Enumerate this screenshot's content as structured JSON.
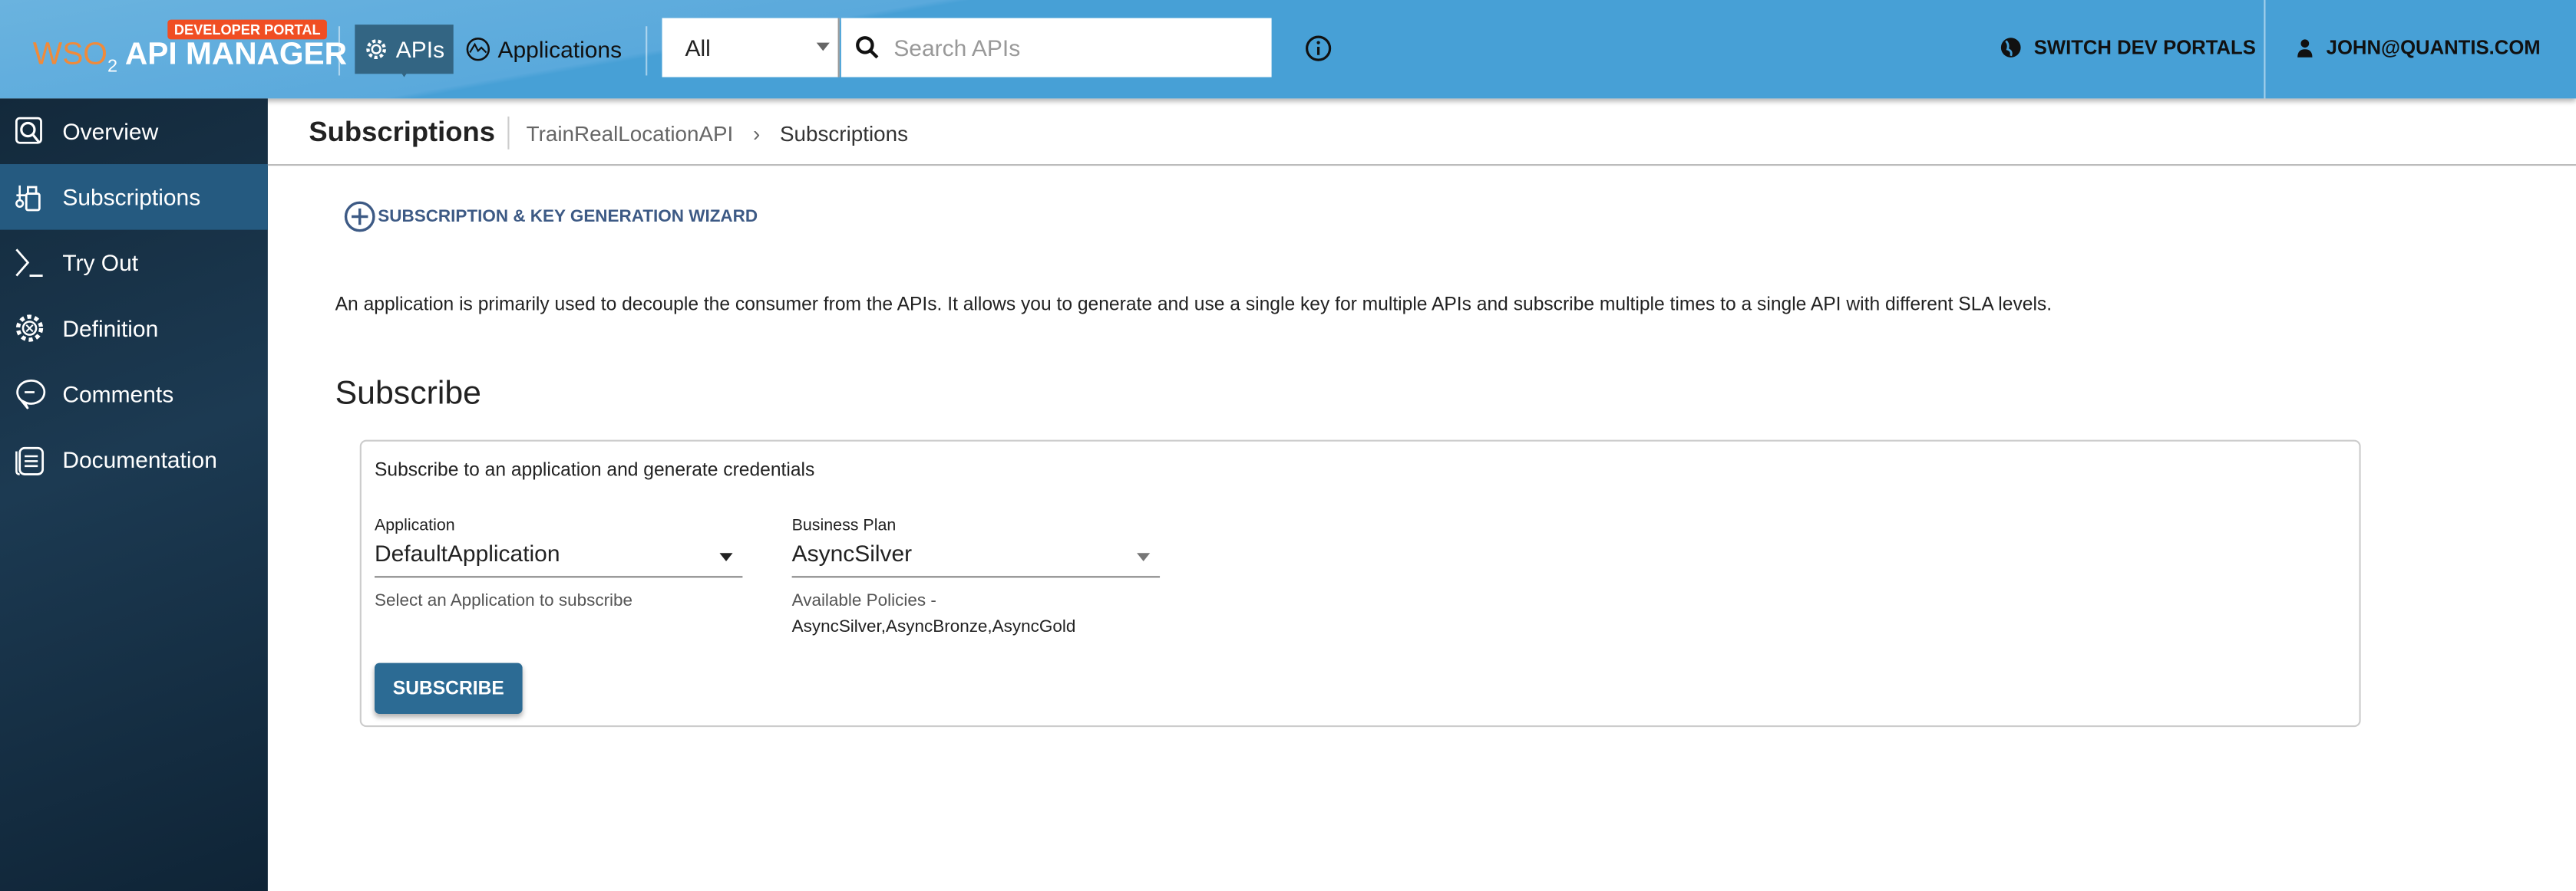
{
  "header": {
    "badge": "DEVELOPER PORTAL",
    "logo_wso": "WSO",
    "logo_two": "2",
    "app_title": "API MANAGER",
    "nav": [
      {
        "label": "APIs",
        "icon": "gear-icon"
      },
      {
        "label": "Applications",
        "icon": "app-icon"
      }
    ],
    "filter_selected": "All",
    "search_placeholder": "Search APIs",
    "switch_portals": "SWITCH DEV PORTALS",
    "user": "JOHN@QUANTIS.COM"
  },
  "sidebar": {
    "items": [
      {
        "label": "Overview",
        "icon": "overview-icon"
      },
      {
        "label": "Subscriptions",
        "icon": "subscriptions-icon"
      },
      {
        "label": "Try Out",
        "icon": "terminal-icon"
      },
      {
        "label": "Definition",
        "icon": "gear-icon"
      },
      {
        "label": "Comments",
        "icon": "comment-icon"
      },
      {
        "label": "Documentation",
        "icon": "document-icon"
      }
    ]
  },
  "breadcrumb": {
    "title": "Subscriptions",
    "api": "TrainRealLocationAPI",
    "current": "Subscriptions"
  },
  "main": {
    "wizard_label": "SUBSCRIPTION & KEY GENERATION WIZARD",
    "description": "An application is primarily used to decouple the consumer from the APIs. It allows you to generate and use a single key for multiple APIs and subscribe multiple times to a single API with different SLA levels.",
    "heading": "Subscribe",
    "card": {
      "subtitle": "Subscribe to an application and generate credentials",
      "application_label": "Application",
      "application_value": "DefaultApplication",
      "application_help": "Select an Application to subscribe",
      "plan_label": "Business Plan",
      "plan_value": "AsyncSilver",
      "plan_help": "Available Policies -",
      "plan_policies": "AsyncSilver,AsyncBronze,AsyncGold",
      "subscribe_button": "SUBSCRIBE"
    }
  },
  "colors": {
    "topbar": "#47a0d6",
    "sidebar": "#13293b",
    "sidebar_active": "#255a80",
    "button": "#2c6b94",
    "badge": "#f04e23"
  }
}
